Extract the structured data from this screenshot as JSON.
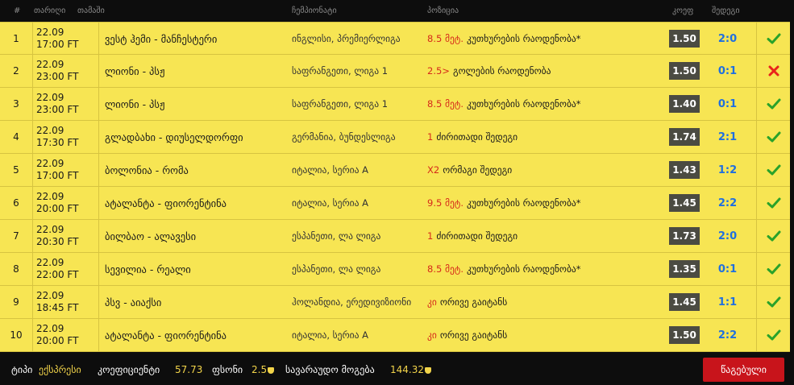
{
  "header": {
    "col_num": "#",
    "col_date": "თარიღი",
    "col_match": "თამაში",
    "col_league": "ჩემპიონატი",
    "col_bet": "პოზიცია",
    "col_odd": "კოეფ",
    "col_score": "შედეგი"
  },
  "rows": [
    {
      "num": "1",
      "date": "22.09",
      "time": "17:00 FT",
      "match": "ვესტ ჰემი - მანჩესტერი",
      "league": "ინგლისი, პრემიერლიგა",
      "bet_value": "8.5 მეტ.",
      "bet_type": "კუთხურების რაოდენობა*",
      "odd": "1.50",
      "score": "2:0",
      "status": "win"
    },
    {
      "num": "2",
      "date": "22.09",
      "time": "23:00 FT",
      "match": "ლიონი - პსჟ",
      "league": "საფრანგეთი, ლიგა 1",
      "bet_value": "2.5>",
      "bet_type": "გოლების რაოდენობა",
      "odd": "1.50",
      "score": "0:1",
      "status": "loss"
    },
    {
      "num": "3",
      "date": "22.09",
      "time": "23:00 FT",
      "match": "ლიონი - პსჟ",
      "league": "საფრანგეთი, ლიგა 1",
      "bet_value": "8.5 მეტ.",
      "bet_type": "კუთხურების რაოდენობა*",
      "odd": "1.40",
      "score": "0:1",
      "status": "win"
    },
    {
      "num": "4",
      "date": "22.09",
      "time": "17:30 FT",
      "match": "გლადბახი - დიუსელდორფი",
      "league": "გერმანია, ბუნდესლიგა",
      "bet_value": "1",
      "bet_type": "ძირითადი შედეგი",
      "odd": "1.74",
      "score": "2:1",
      "status": "win"
    },
    {
      "num": "5",
      "date": "22.09",
      "time": "17:00 FT",
      "match": "ბოლონია - რომა",
      "league": "იტალია, სერია A",
      "bet_value": "X2",
      "bet_type": "ორმაგი შედეგი",
      "odd": "1.43",
      "score": "1:2",
      "status": "win"
    },
    {
      "num": "6",
      "date": "22.09",
      "time": "20:00 FT",
      "match": "ატალანტა - ფიორენტინა",
      "league": "იტალია, სერია A",
      "bet_value": "9.5 მეტ.",
      "bet_type": "კუთხურების რაოდენობა*",
      "odd": "1.45",
      "score": "2:2",
      "status": "win"
    },
    {
      "num": "7",
      "date": "22.09",
      "time": "20:30 FT",
      "match": "ბილბაო - ალავესი",
      "league": "ესპანეთი, ლა ლიგა",
      "bet_value": "1",
      "bet_type": "ძირითადი შედეგი",
      "odd": "1.73",
      "score": "2:0",
      "status": "win"
    },
    {
      "num": "8",
      "date": "22.09",
      "time": "22:00 FT",
      "match": "სევილია - რეალი",
      "league": "ესპანეთი, ლა ლიგა",
      "bet_value": "8.5 მეტ.",
      "bet_type": "კუთხურების რაოდენობა*",
      "odd": "1.35",
      "score": "0:1",
      "status": "win"
    },
    {
      "num": "9",
      "date": "22.09",
      "time": "18:45 FT",
      "match": "პსვ - აიაქსი",
      "league": "ჰოლანდია, ერედივიზიონი",
      "bet_value": "კი",
      "bet_type": "ორივე გაიტანს",
      "odd": "1.45",
      "score": "1:1",
      "status": "win"
    },
    {
      "num": "10",
      "date": "22.09",
      "time": "20:00 FT",
      "match": "ატალანტა - ფიორენტინა",
      "league": "იტალია, სერია A",
      "bet_value": "კი",
      "bet_type": "ორივე გაიტანს",
      "odd": "1.50",
      "score": "2:2",
      "status": "win"
    }
  ],
  "footer": {
    "type_label": "ტიპი",
    "type_value": "ექსპრესი",
    "coef_label": "კოეფიციენტი",
    "coef_value": "57.73",
    "stake_label": "ფსონი",
    "stake_value": "2.5",
    "win_label": "სავარაუდო მოგება",
    "win_value": "144.32",
    "submit_label": "წაგებული"
  },
  "colors": {
    "row_bg": "#f7e553",
    "bet_value": "#d62a1a",
    "score": "#1f6fe0",
    "win": "#2aa22a",
    "loss": "#e8231b",
    "submit_bg": "#c8141b",
    "footer_value": "#f2d44a"
  },
  "icons": {
    "win": "checkmark-icon",
    "loss": "cross-icon",
    "currency": "lari-icon"
  }
}
